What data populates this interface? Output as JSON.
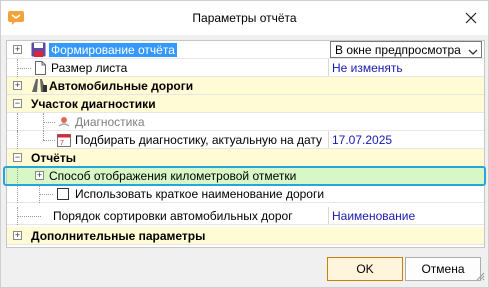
{
  "window": {
    "title": "Параметры отчёта"
  },
  "rows": {
    "formation": {
      "label": "Формирование отчёта",
      "value": "В окне предпросмотра"
    },
    "page_size": {
      "label": "Размер листа",
      "value": "Не изменять"
    },
    "roads": {
      "label": "Автомобильные дороги"
    },
    "diag_section": {
      "label": "Участок диагностики"
    },
    "diagnostics": {
      "label": "Диагностика"
    },
    "pick_diag": {
      "label": "Подбирать диагностику, актуальную на дату",
      "value": "17.07.2025"
    },
    "reports": {
      "label": "Отчёты"
    },
    "km_display": {
      "label": "Способ отображения километровой отметки"
    },
    "short_name": {
      "label": "Использовать краткое наименование дороги"
    },
    "sort_order": {
      "label": "Порядок сортировки автомобильных дорог",
      "value": "Наименование"
    },
    "extra": {
      "label": "Дополнительные параметры"
    }
  },
  "buttons": {
    "ok": "OK",
    "cancel": "Отмена"
  },
  "colors": {
    "section_bg": "#fffbd4",
    "selection": "#3399ff",
    "green_row": "#d8f7c7",
    "focus": "#2aa3d6",
    "value_text": "#1a1ab0"
  }
}
